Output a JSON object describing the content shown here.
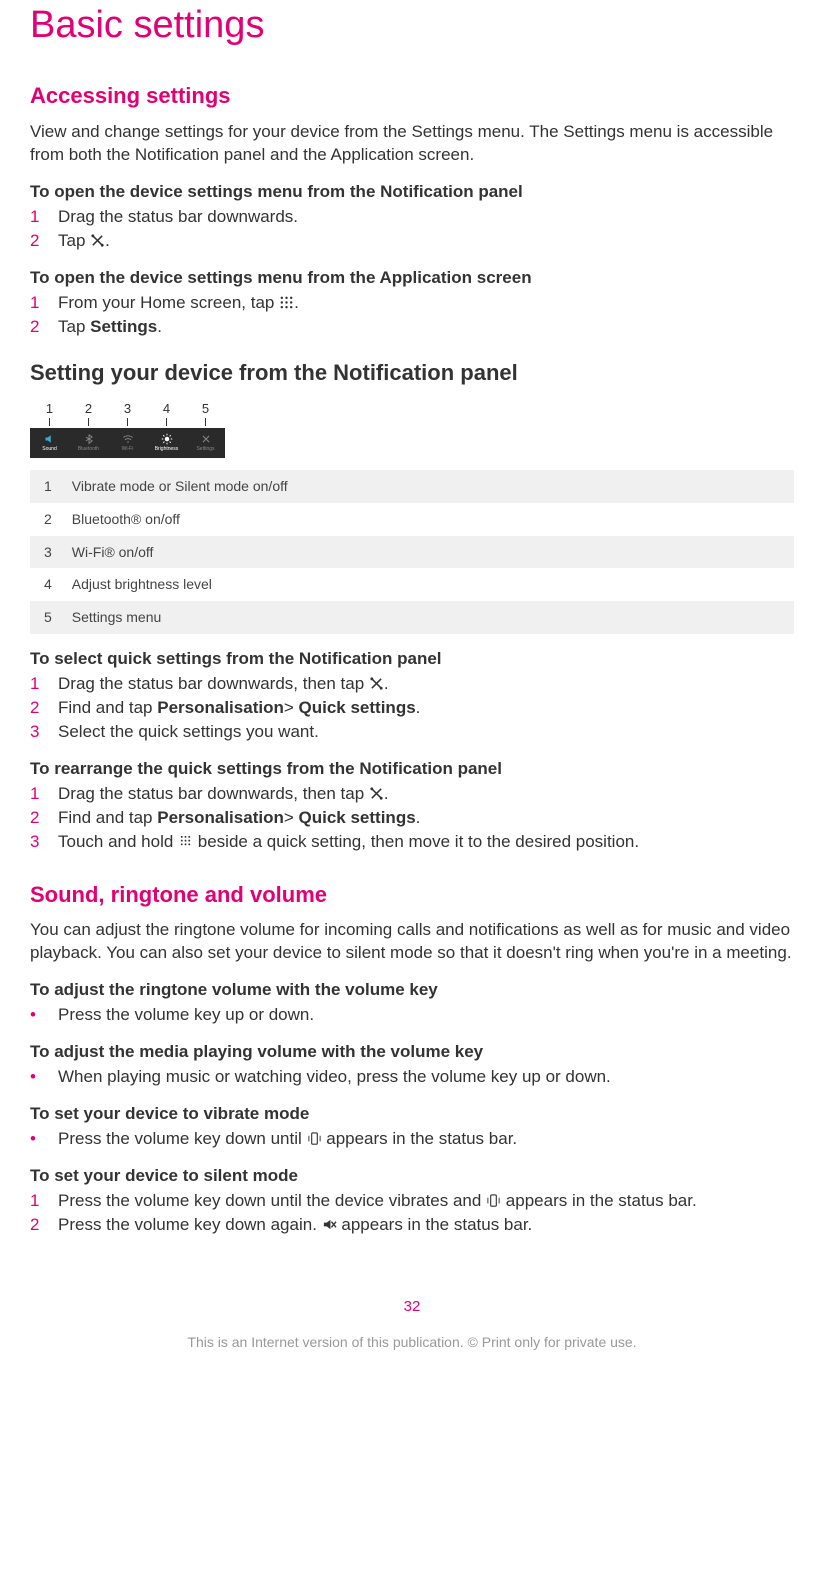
{
  "title": "Basic settings",
  "section_accessing": {
    "heading": "Accessing settings",
    "intro": "View and change settings for your device from the Settings menu. The Settings menu is accessible from both the Notification panel and the Application screen.",
    "task1": {
      "title": "To open the device settings menu from the Notification panel",
      "steps": [
        "Drag the status bar downwards.",
        "Tap "
      ]
    },
    "task2": {
      "title": "To open the device settings menu from the Application screen",
      "step1_a": "From your Home screen, tap ",
      "step2_a": "Tap ",
      "step2_b": "Settings",
      "step2_c": "."
    },
    "sub_heading": "Setting your device from the Notification panel",
    "quick_panel": {
      "callouts": [
        "1",
        "2",
        "3",
        "4",
        "5"
      ],
      "items": [
        {
          "label": "Sound",
          "icon": "volume"
        },
        {
          "label": "Bluetooth",
          "icon": "bluetooth"
        },
        {
          "label": "Wi-Fi",
          "icon": "wifi"
        },
        {
          "label": "Brightness",
          "icon": "brightness"
        },
        {
          "label": "Settings",
          "icon": "settings"
        }
      ]
    },
    "legend": [
      {
        "num": "1",
        "desc": "Vibrate mode or Silent mode on/off"
      },
      {
        "num": "2",
        "desc": "Bluetooth® on/off"
      },
      {
        "num": "3",
        "desc": "Wi-Fi® on/off"
      },
      {
        "num": "4",
        "desc": "Adjust brightness level"
      },
      {
        "num": "5",
        "desc": "Settings menu"
      }
    ],
    "task3": {
      "title": "To select quick settings from the Notification panel",
      "step1": "Drag the status bar downwards, then tap ",
      "step2_a": "Find and tap ",
      "step2_b": "Personalisation",
      "step2_c": "> ",
      "step2_d": "Quick settings",
      "step2_e": ".",
      "step3": "Select the quick settings you want."
    },
    "task4": {
      "title": "To rearrange the quick settings from the Notification panel",
      "step1": "Drag the status bar downwards, then tap ",
      "step2_a": "Find and tap ",
      "step2_b": "Personalisation",
      "step2_c": "> ",
      "step2_d": "Quick settings",
      "step2_e": ".",
      "step3_a": "Touch and hold ",
      "step3_b": " beside a quick setting, then move it to the desired position."
    }
  },
  "section_sound": {
    "heading": "Sound, ringtone and volume",
    "intro": "You can adjust the ringtone volume for incoming calls and notifications as well as for music and video playback. You can also set your device to silent mode so that it doesn't ring when you're in a meeting.",
    "task1": {
      "title": "To adjust the ringtone volume with the volume key",
      "bullet": "Press the volume key up or down."
    },
    "task2": {
      "title": "To adjust the media playing volume with the volume key",
      "bullet": "When playing music or watching video, press the volume key up or down."
    },
    "task3": {
      "title": "To set your device to vibrate mode",
      "bullet_a": "Press the volume key down until ",
      "bullet_b": " appears in the status bar."
    },
    "task4": {
      "title": "To set your device to silent mode",
      "step1_a": "Press the volume key down until the device vibrates and ",
      "step1_b": " appears in the status bar.",
      "step2_a": "Press the volume key down again. ",
      "step2_b": " appears in the status bar."
    }
  },
  "page_number": "32",
  "footer": "This is an Internet version of this publication. © Print only for private use."
}
